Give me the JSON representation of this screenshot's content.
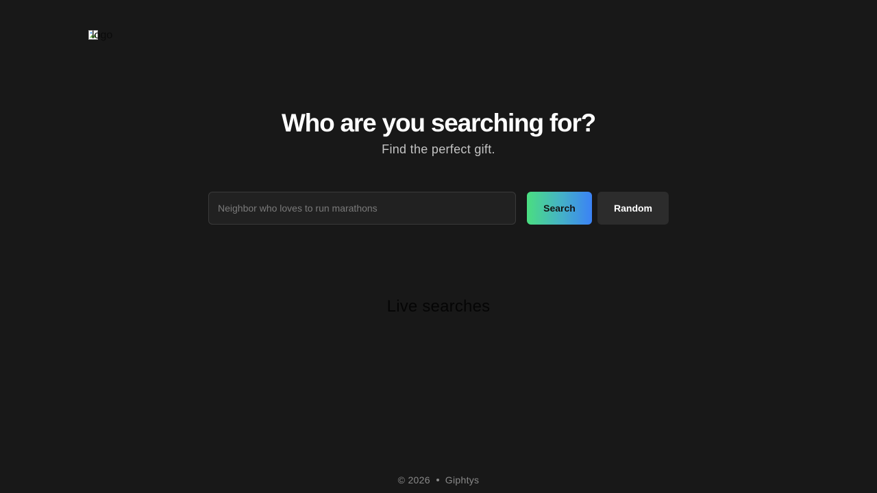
{
  "header": {
    "logo_alt": "logo"
  },
  "hero": {
    "title": "Who are you searching for?",
    "subtitle": "Find the perfect gift."
  },
  "search": {
    "placeholder": "Neighbor who loves to run marathons",
    "value": "",
    "search_label": "Search",
    "random_label": "Random"
  },
  "live": {
    "title": "Live searches"
  },
  "footer": {
    "copyright": "© 2026",
    "brand": "Giphtys"
  },
  "colors": {
    "background": "#181818",
    "gradient_start": "#4ade80",
    "gradient_end": "#3b82f6",
    "random_button": "#2c2c2c"
  }
}
